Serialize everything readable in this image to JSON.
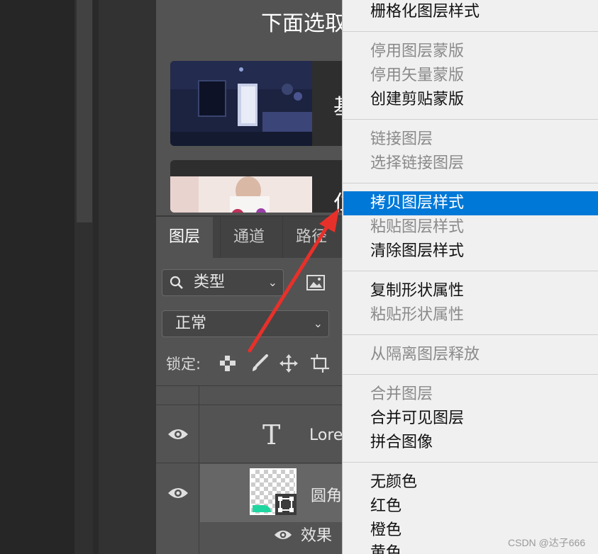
{
  "preview": {
    "title": "下面选取",
    "card1_char": "基",
    "card2_char": "仁"
  },
  "layers_panel": {
    "tabs": [
      "图层",
      "通道",
      "路径"
    ],
    "filter_select": "类型",
    "blend_select": "正常",
    "lock_label": "锁定:",
    "layers": [
      {
        "name": "Lore",
        "type": "text",
        "glyph": "T"
      },
      {
        "name": "圆角",
        "type": "shape"
      }
    ],
    "effects_label": "效果"
  },
  "context_menu": {
    "groups": [
      [
        {
          "label": "栅格化图层样式",
          "enabled": true
        }
      ],
      [
        {
          "label": "停用图层蒙版",
          "enabled": false
        },
        {
          "label": "停用矢量蒙版",
          "enabled": false
        },
        {
          "label": "创建剪贴蒙版",
          "enabled": true
        }
      ],
      [
        {
          "label": "链接图层",
          "enabled": false
        },
        {
          "label": "选择链接图层",
          "enabled": false
        }
      ],
      [
        {
          "label": "拷贝图层样式",
          "enabled": true,
          "highlighted": true
        },
        {
          "label": "粘贴图层样式",
          "enabled": false
        },
        {
          "label": "清除图层样式",
          "enabled": true
        }
      ],
      [
        {
          "label": "复制形状属性",
          "enabled": true
        },
        {
          "label": "粘贴形状属性",
          "enabled": false
        }
      ],
      [
        {
          "label": "从隔离图层释放",
          "enabled": false
        }
      ],
      [
        {
          "label": "合并图层",
          "enabled": false
        },
        {
          "label": "合并可见图层",
          "enabled": true
        },
        {
          "label": "拼合图像",
          "enabled": true
        }
      ],
      [
        {
          "label": "无颜色",
          "enabled": true
        },
        {
          "label": "红色",
          "enabled": true
        },
        {
          "label": "橙色",
          "enabled": true
        },
        {
          "label": "黄色",
          "enabled": true
        }
      ]
    ]
  },
  "watermark": "CSDN @达子666",
  "colors": {
    "menu_highlight": "#0078d7",
    "annotation_arrow": "#e8302a",
    "accent_teal": "#20d6a0"
  }
}
